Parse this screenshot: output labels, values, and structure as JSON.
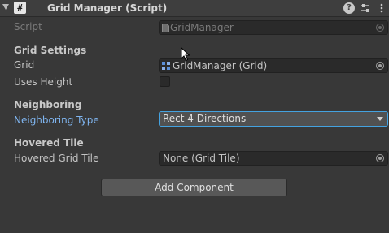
{
  "component": {
    "title": "Grid Manager (Script)",
    "header_icons": [
      "foldout-arrow-icon",
      "csharp-script-icon",
      "help-icon",
      "presets-icon",
      "context-menu-icon"
    ],
    "help_glyph": "?"
  },
  "script": {
    "label": "Script",
    "value": "GridManager"
  },
  "grid_settings": {
    "header": "Grid Settings",
    "grid_label": "Grid",
    "grid_value": "GridManager (Grid)",
    "uses_height_label": "Uses Height",
    "uses_height_checked": false
  },
  "neighboring": {
    "header": "Neighboring",
    "type_label": "Neighboring Type",
    "type_value": "Rect 4 Directions"
  },
  "hovered_tile": {
    "header": "Hovered Tile",
    "label": "Hovered Grid Tile",
    "value": "None (Grid Tile)"
  },
  "add_component_label": "Add Component",
  "colors": {
    "background": "#383838",
    "field_bg": "#2a2a2a",
    "accent_blue": "#44a2e0",
    "label_blue": "#7fb5f0"
  }
}
